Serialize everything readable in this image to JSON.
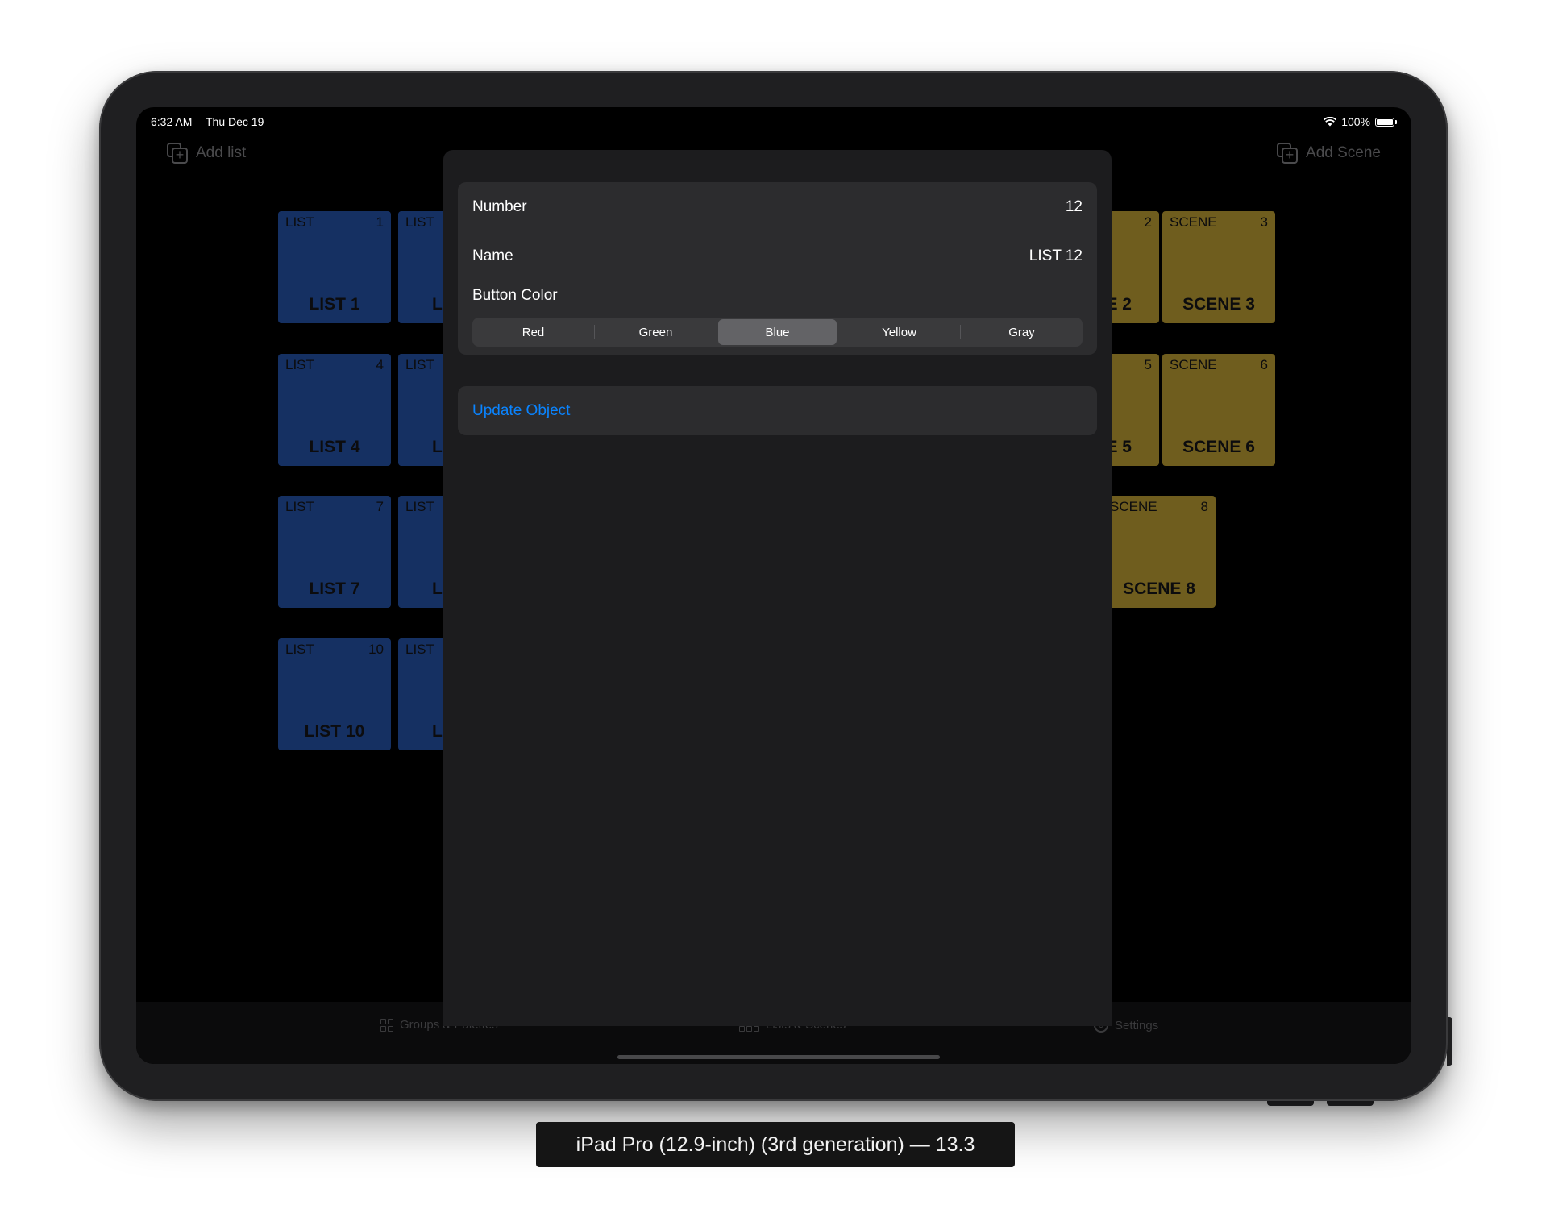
{
  "status": {
    "time": "6:32 AM",
    "date": "Thu Dec 19",
    "battery": "100%"
  },
  "toolbar": {
    "add_list": "Add list",
    "add_scene": "Add Scene"
  },
  "lists": {
    "kind_label": "LIST",
    "t1": {
      "num": "1",
      "name": "LIST 1"
    },
    "t2": {
      "name": "LI"
    },
    "t4": {
      "num": "4",
      "name": "LIST 4"
    },
    "t5": {
      "name": "LI"
    },
    "t7": {
      "num": "7",
      "name": "LIST 7"
    },
    "t8": {
      "name": "LI"
    },
    "t10": {
      "num": "10",
      "name": "LIST 10"
    },
    "t11": {
      "name": "LI"
    }
  },
  "scenes": {
    "kind_label": "SCENE",
    "s2": {
      "num": "2",
      "name": "E 2"
    },
    "s3": {
      "num": "3",
      "name": "SCENE 3"
    },
    "s5": {
      "num": "5",
      "name": "E 5"
    },
    "s6": {
      "num": "6",
      "name": "SCENE 6"
    },
    "s8": {
      "num": "8",
      "name": "SCENE 8"
    }
  },
  "colors": {
    "list_tile": "#153062",
    "scene_tile": "#6f5d1e",
    "link": "#0a84ff"
  },
  "modal": {
    "number_label": "Number",
    "number_value": "12",
    "name_label": "Name",
    "name_value": "LIST 12",
    "color_label": "Button Color",
    "color_options": [
      "Red",
      "Green",
      "Blue",
      "Yellow",
      "Gray"
    ],
    "selected_color": "Blue",
    "update_label": "Update Object"
  },
  "tabs": {
    "groups": "Groups & Palettes",
    "lists": "Lists & Scenes",
    "settings": "Settings"
  },
  "caption": "iPad Pro (12.9-inch) (3rd generation) — 13.3"
}
